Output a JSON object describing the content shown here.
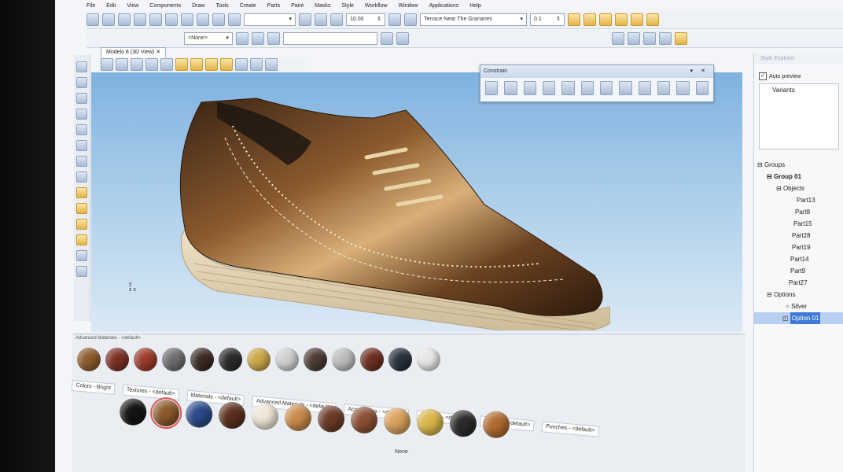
{
  "menu": [
    "File",
    "Edit",
    "View",
    "Components",
    "Draw",
    "Tools",
    "Create",
    "Parts",
    "Paint",
    "Masks",
    "Style",
    "Workflow",
    "Window",
    "Applications",
    "Help"
  ],
  "toolbar": {
    "size_value": "10.00",
    "scene_combo": "Terrace Near The Granaries",
    "scale_value": "0.1",
    "none_combo": "<None>"
  },
  "view_tab": "Modelo 8 (3D View)",
  "axis": {
    "y": "y",
    "zx": "z  x"
  },
  "constrain": {
    "title": "Constrain"
  },
  "style_explorer": {
    "title": "Style Explorer",
    "auto_preview": "Auto preview",
    "variants": "Variants"
  },
  "tree": {
    "groups": "Groups",
    "group01": "Group 01",
    "objects": "Objects",
    "parts": [
      "Part13",
      "Part8",
      "Part15",
      "Part28",
      "Part19",
      "Part14",
      "Part9",
      "Part27"
    ],
    "options": "Options",
    "silver": "Silver",
    "option01": "Option 01"
  },
  "bottom": {
    "panel_label": "Advanced Materials - <default>",
    "tabs": [
      "Colors - Bright",
      "Textures - <default>",
      "Materials - <default>",
      "Advanced Materials - <default>",
      "Accessories - <default>",
      "Stitches - <default>",
      "Stamps - <default>",
      "Punches - <default>"
    ],
    "none_label": "None"
  },
  "swatch_colors_row1": [
    "#8a5a2b",
    "#7a2f22",
    "#9b3a2a",
    "#6c6c6c",
    "#3a2a22",
    "#2a2a2a",
    "#c9a646",
    "#cfcfcf",
    "#4a3b33",
    "#bbbbbb",
    "#6b2f20",
    "#27303d",
    "#e6e6e6"
  ],
  "swatch_colors_row2": [
    "#141414",
    "#8a5a2b",
    "#2b4a8a",
    "#5a2f1e",
    "#efe6d6",
    "#c98a4a",
    "#6b3a26",
    "#8a5034",
    "#d9a25c",
    "#d8b64a",
    "#2a2a2a",
    "#b06a2e"
  ]
}
